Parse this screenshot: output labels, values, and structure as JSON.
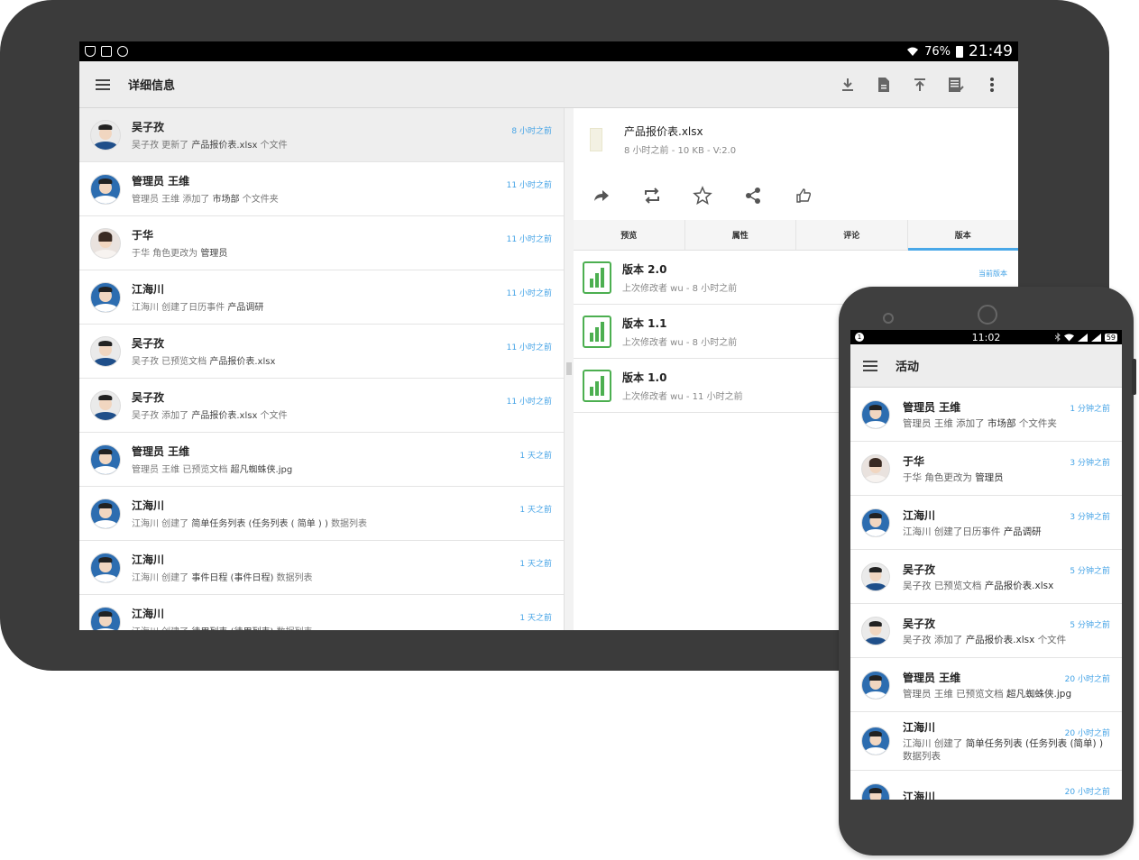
{
  "tablet": {
    "status_bar": {
      "battery": "76%",
      "time": "21:49"
    },
    "toolbar": {
      "title": "详细信息",
      "actions": [
        "download-icon",
        "document-icon",
        "upload-icon",
        "edit-document-icon",
        "more-vert-icon"
      ]
    },
    "activities": [
      {
        "name": "吴子孜",
        "action": "吴子孜 更新了",
        "target": "产品报价表.xlsx",
        "suffix": "个文件",
        "time": "8 小时之前",
        "avatar": "white"
      },
      {
        "name": "管理员 王维",
        "action": "管理员 王维 添加了",
        "target": "市场部",
        "suffix": "个文件夹",
        "time": "11 小时之前",
        "avatar": "blue"
      },
      {
        "name": "于华",
        "action": "于华 角色更改为",
        "target": "管理员",
        "suffix": "",
        "time": "11 小时之前",
        "avatar": "female"
      },
      {
        "name": "江海川",
        "action": "江海川 创建了日历事件",
        "target": "产品调研",
        "suffix": "",
        "time": "11 小时之前",
        "avatar": "blue"
      },
      {
        "name": "吴子孜",
        "action": "吴子孜 已预览文档",
        "target": "产品报价表.xlsx",
        "suffix": "",
        "time": "11 小时之前",
        "avatar": "white"
      },
      {
        "name": "吴子孜",
        "action": "吴子孜 添加了",
        "target": "产品报价表.xlsx",
        "suffix": "个文件",
        "time": "11 小时之前",
        "avatar": "white"
      },
      {
        "name": "管理员 王维",
        "action": "管理员 王维 已预览文档",
        "target": "超凡蜘蛛侠.jpg",
        "suffix": "",
        "time": "1 天之前",
        "avatar": "blue"
      },
      {
        "name": "江海川",
        "action": "江海川 创建了",
        "target": "简单任务列表 (任务列表 ( 简单 ) )",
        "suffix": "数据列表",
        "time": "1 天之前",
        "avatar": "blue"
      },
      {
        "name": "江海川",
        "action": "江海川 创建了",
        "target": "事件日程 (事件日程)",
        "suffix": "数据列表",
        "time": "1 天之前",
        "avatar": "blue"
      },
      {
        "name": "江海川",
        "action": "江海川 创建了",
        "target": "待用列表 (待用列表)",
        "suffix": "数据列表",
        "time": "1 天之前",
        "avatar": "blue"
      }
    ],
    "file": {
      "name": "产品报价表.xlsx",
      "meta": "8 小时之前 - 10 KB - V:2.0",
      "actions": [
        "share-forward-icon",
        "repeat-icon",
        "star-icon",
        "share-icon",
        "thumbs-up-icon"
      ],
      "tabs": [
        "预览",
        "属性",
        "评论",
        "版本"
      ],
      "active_tab": "版本",
      "versions": [
        {
          "name": "版本 2.0",
          "meta": "上次修改者 wu - 8 小时之前",
          "badge": "当前版本"
        },
        {
          "name": "版本 1.1",
          "meta": "上次修改者 wu - 8 小时之前",
          "badge": ""
        },
        {
          "name": "版本 1.0",
          "meta": "上次修改者 wu - 11 小时之前",
          "badge": ""
        }
      ]
    }
  },
  "phone": {
    "status_bar": {
      "time": "11:02",
      "badge": "59",
      "notification": "1"
    },
    "toolbar": {
      "title": "活动"
    },
    "activities": [
      {
        "name": "管理员 王维",
        "action": "管理员 王维 添加了",
        "target": "市场部",
        "suffix": "个文件夹",
        "time": "1 分钟之前",
        "avatar": "blue"
      },
      {
        "name": "于华",
        "action": "于华 角色更改为",
        "target": "管理员",
        "suffix": "",
        "time": "3 分钟之前",
        "avatar": "female"
      },
      {
        "name": "江海川",
        "action": "江海川 创建了日历事件",
        "target": "产品调研",
        "suffix": "",
        "time": "3 分钟之前",
        "avatar": "blue"
      },
      {
        "name": "吴子孜",
        "action": "吴子孜 已预览文档",
        "target": "产品报价表.xlsx",
        "suffix": "",
        "time": "5 分钟之前",
        "avatar": "white"
      },
      {
        "name": "吴子孜",
        "action": "吴子孜 添加了",
        "target": "产品报价表.xlsx",
        "suffix": "个文件",
        "time": "5 分钟之前",
        "avatar": "white"
      },
      {
        "name": "管理员 王维",
        "action": "管理员 王维 已预览文档",
        "target": "超凡蜘蛛侠.jpg",
        "suffix": "",
        "time": "20 小时之前",
        "avatar": "blue"
      },
      {
        "name": "江海川",
        "action": "江海川 创建了",
        "target": "简单任务列表 (任务列表 (简单) )",
        "suffix": "数据列表",
        "time": "20 小时之前",
        "avatar": "blue"
      },
      {
        "name": "江海川",
        "action": "",
        "target": "",
        "suffix": "",
        "time": "20 小时之前",
        "avatar": "blue"
      }
    ]
  }
}
